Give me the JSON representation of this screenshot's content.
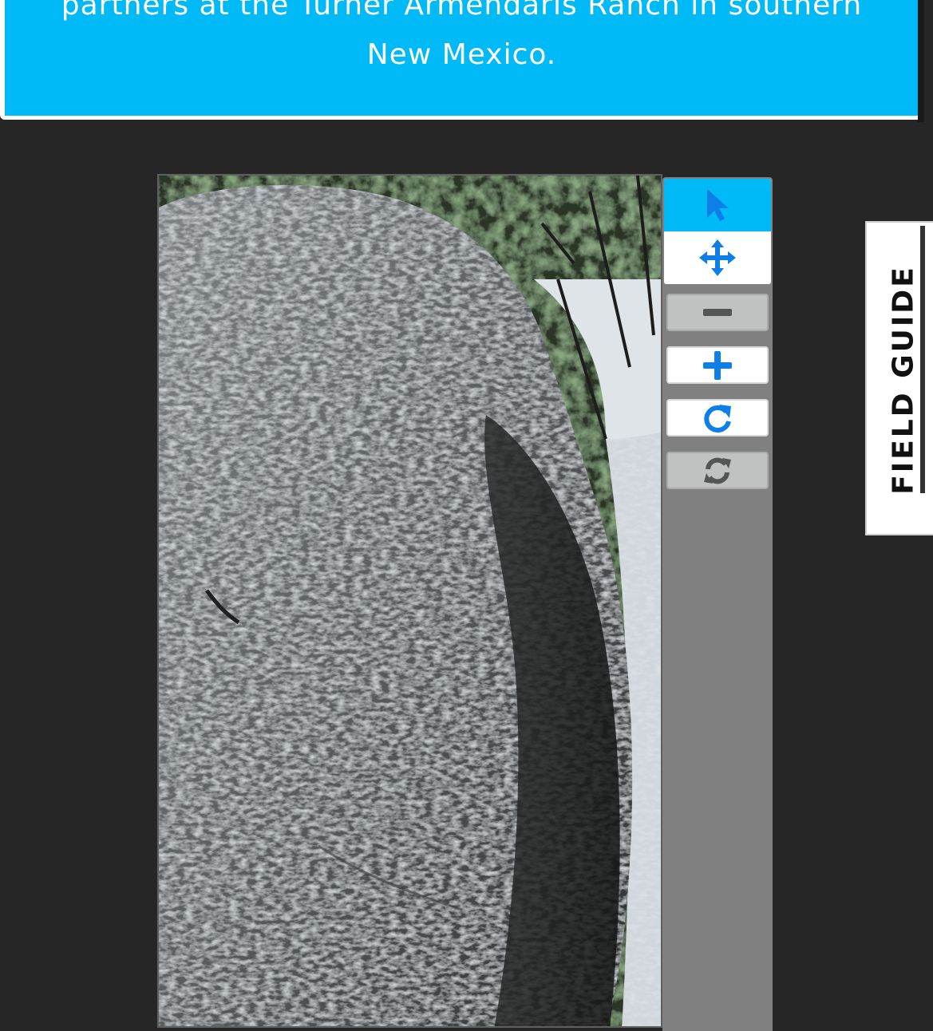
{
  "banner": {
    "text_line1": "partners at the Turner Armendaris Ranch in southern",
    "text_line2": "New Mexico.",
    "color": "#00b9f7"
  },
  "toolbar": {
    "tools": [
      {
        "name": "annotate-tool",
        "icon": "pointer-arrow-icon",
        "active": true
      },
      {
        "name": "move-tool",
        "icon": "move-arrows-icon",
        "active": false
      }
    ],
    "zoom_controls": [
      {
        "name": "zoom-out-button",
        "icon": "minus-icon",
        "enabled": false
      },
      {
        "name": "zoom-in-button",
        "icon": "plus-icon",
        "enabled": true
      },
      {
        "name": "rotate-button",
        "icon": "rotate-clockwise-icon",
        "enabled": true
      },
      {
        "name": "reset-button",
        "icon": "refresh-icon",
        "enabled": false
      }
    ],
    "accent": "#0e7fe6",
    "active_bg": "#00b9f7"
  },
  "field_guide": {
    "label": "FIELD GUIDE"
  },
  "subject": {
    "description_icon": "camera-trap-image"
  }
}
